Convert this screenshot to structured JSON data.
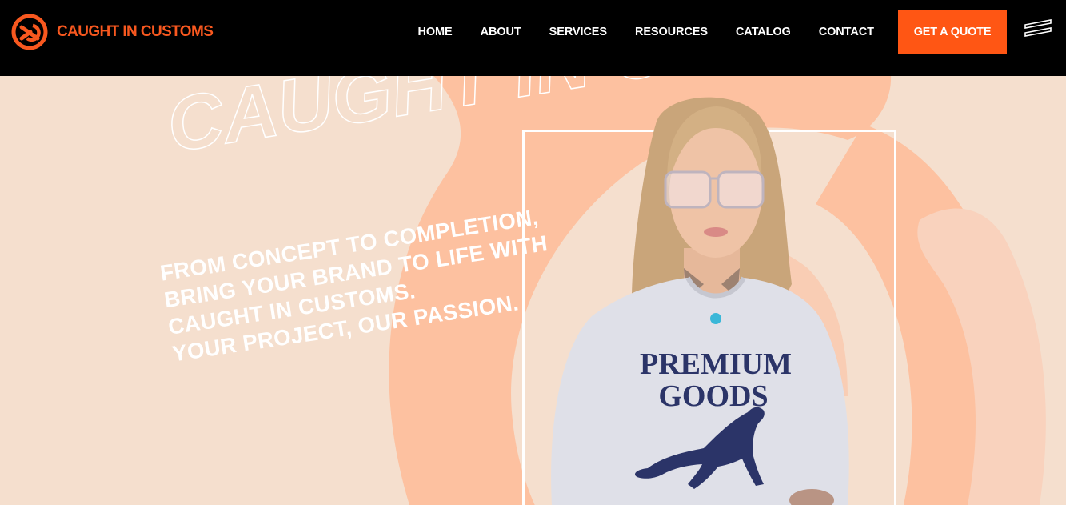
{
  "brand": {
    "name": "CAUGHT IN CUSTOMS",
    "accent_color": "#ff5614",
    "logo_icon": "ci-monogram-icon"
  },
  "nav": {
    "items": [
      {
        "label": "HOME"
      },
      {
        "label": "ABOUT"
      },
      {
        "label": "SERVICES"
      },
      {
        "label": "RESOURCES"
      },
      {
        "label": "CATALOG"
      },
      {
        "label": "CONTACT"
      }
    ],
    "cta_label": "GET A QUOTE",
    "menu_icon": "hamburger-menu-icon"
  },
  "hero": {
    "watermark": "CAUGHT IN CUSTOMS",
    "headline_lines": [
      "FROM CONCEPT TO COMPLETION,",
      "BRING YOUR BRAND TO LIFE WITH",
      "CAUGHT IN CUSTOMS.",
      "YOUR PROJECT, OUR PASSION."
    ],
    "shirt_print": {
      "line1": "PREMIUM",
      "line2": "GOODS"
    },
    "background_color": "#f5dfce",
    "shape_color": "#fdc1a0"
  }
}
